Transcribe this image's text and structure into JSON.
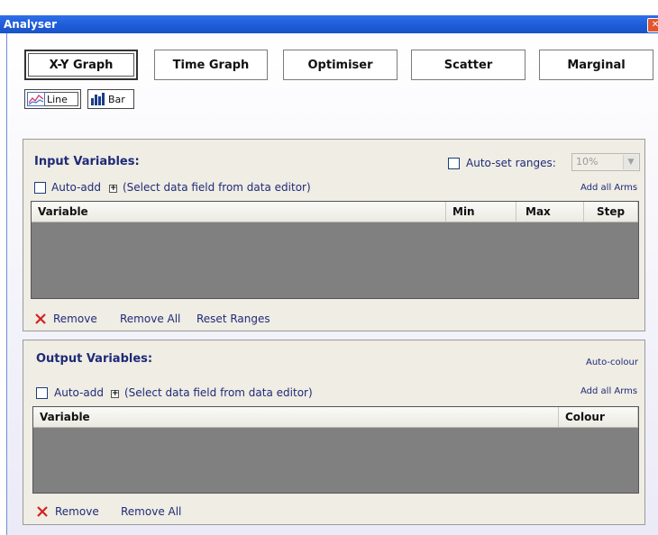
{
  "window": {
    "title": "Analyser",
    "close_glyph": "✕"
  },
  "tabs": [
    {
      "label": "X-Y Graph",
      "active": true
    },
    {
      "label": "Time Graph",
      "active": false
    },
    {
      "label": "Optimiser",
      "active": false
    },
    {
      "label": "Scatter",
      "active": false
    },
    {
      "label": "Marginal",
      "active": false
    }
  ],
  "graph_types": [
    {
      "label": "Line",
      "icon": "line-chart-icon",
      "active": true
    },
    {
      "label": "Bar",
      "icon": "bar-chart-icon",
      "active": false
    }
  ],
  "input_panel": {
    "title": "Input Variables:",
    "auto_set_ranges_label": "Auto-set ranges:",
    "auto_set_ranges_checked": false,
    "range_value": "10%",
    "auto_add_label": "Auto-add",
    "auto_add_checked": false,
    "select_field_text": "(Select data field from data editor)",
    "add_all_arms": "Add all Arms",
    "columns": [
      "Variable",
      "Min",
      "Max",
      "Step"
    ],
    "rows": [],
    "remove": "Remove",
    "remove_all": "Remove All",
    "reset_ranges": "Reset Ranges"
  },
  "output_panel": {
    "title": "Output Variables:",
    "auto_colour": "Auto-colour",
    "auto_add_label": "Auto-add",
    "auto_add_checked": false,
    "select_field_text": "(Select data field from data editor)",
    "add_all_arms": "Add all Arms",
    "columns": [
      "Variable",
      "Colour"
    ],
    "rows": [],
    "remove": "Remove",
    "remove_all": "Remove All"
  },
  "colors": {
    "titlebar": "#1c5bd6",
    "text": "#1f2a78",
    "panel": "#efede4",
    "table_empty": "#808080",
    "remove_x": "#d42020"
  }
}
